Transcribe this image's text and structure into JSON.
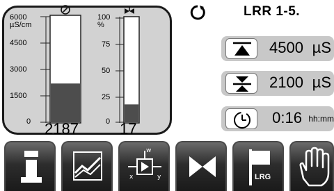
{
  "header": {
    "title": "LRR 1-5."
  },
  "gauges": {
    "conductivity": {
      "unit_line1": "6000",
      "unit_line2": "µS/cm",
      "ticks": [
        "6000",
        "4500",
        "3000",
        "1500",
        "0"
      ],
      "value_label": "2187",
      "value": 2187,
      "max": 6000
    },
    "valve": {
      "unit_line1": "100",
      "unit_line2": "%",
      "ticks": [
        "100",
        "75",
        "50",
        "25",
        "0"
      ],
      "value_label": "17",
      "value": 17,
      "max": 100
    }
  },
  "setpoints": {
    "upper": {
      "value": "4500",
      "unit": "µS"
    },
    "lower": {
      "value": "2100",
      "unit": "µS"
    },
    "timer": {
      "value": "0:16",
      "unit": "hh:mm"
    }
  },
  "toolbar": {
    "lrg_label": "LRG"
  },
  "colors": {
    "panel": "#d2d2d2",
    "bar_fill": "#4d4d4d",
    "button_dark": "#1a1a1a"
  }
}
